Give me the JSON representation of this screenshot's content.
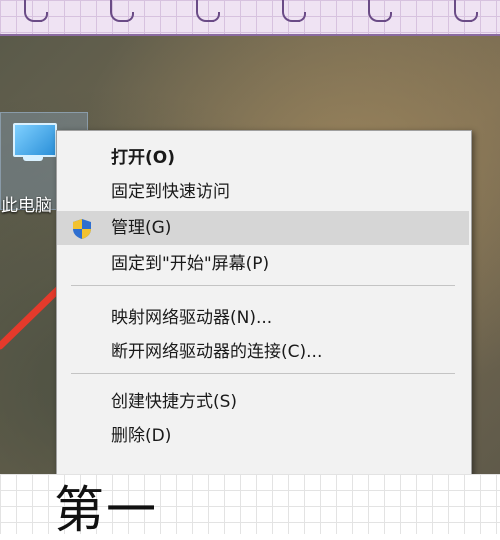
{
  "desktop": {
    "icon_label": "此电脑"
  },
  "context_menu": {
    "items": [
      {
        "label": "打开(O)",
        "bold": true
      },
      {
        "label": "固定到快速访问"
      },
      {
        "label": "管理(G)",
        "icon": "uac-shield-icon",
        "highlighted": true
      },
      {
        "label": "固定到\"开始\"屏幕(P)"
      },
      {
        "label": "映射网络驱动器(N)..."
      },
      {
        "label": "断开网络驱动器的连接(C)..."
      },
      {
        "label": "创建快捷方式(S)"
      },
      {
        "label": "删除(D)"
      }
    ]
  },
  "caption": {
    "text": "第一"
  },
  "colors": {
    "highlight": "#d6d6d6",
    "arrow": "#e53a2b",
    "notebook_purple": "#efe3f3"
  }
}
